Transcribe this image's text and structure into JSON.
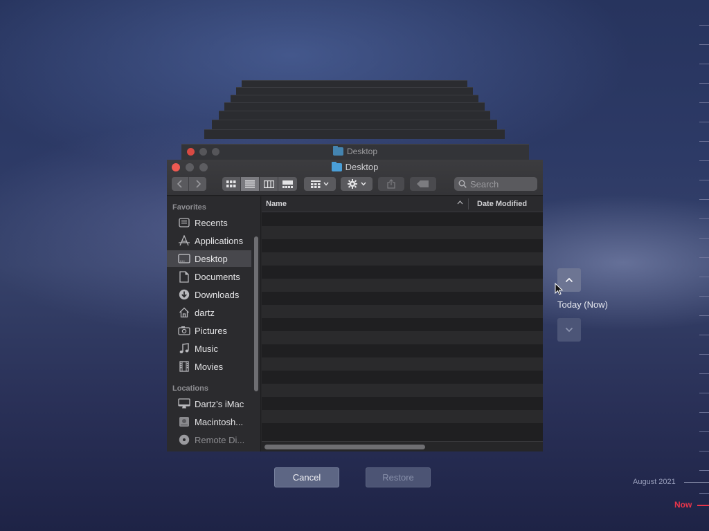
{
  "back_window": {
    "title": "Desktop"
  },
  "window": {
    "title": "Desktop",
    "search_placeholder": "Search",
    "sidebar": {
      "sections": [
        {
          "header": "Favorites",
          "items": [
            {
              "label": "Recents",
              "icon": "recents-icon"
            },
            {
              "label": "Applications",
              "icon": "applications-icon"
            },
            {
              "label": "Desktop",
              "icon": "desktop-icon",
              "selected": true
            },
            {
              "label": "Documents",
              "icon": "documents-icon"
            },
            {
              "label": "Downloads",
              "icon": "downloads-icon"
            },
            {
              "label": "dartz",
              "icon": "home-icon"
            },
            {
              "label": "Pictures",
              "icon": "pictures-icon"
            },
            {
              "label": "Music",
              "icon": "music-icon"
            },
            {
              "label": "Movies",
              "icon": "movies-icon"
            }
          ]
        },
        {
          "header": "Locations",
          "items": [
            {
              "label": "Dartz’s iMac",
              "icon": "imac-icon"
            },
            {
              "label": "Macintosh...",
              "icon": "disk-icon"
            },
            {
              "label": "Remote Di...",
              "icon": "remote-disc-icon"
            }
          ]
        }
      ]
    },
    "columns": {
      "name": "Name",
      "date_modified": "Date Modified"
    }
  },
  "dialog": {
    "cancel": "Cancel",
    "restore": "Restore"
  },
  "time_machine": {
    "current": "Today (Now)",
    "timeline_month": "August 2021",
    "now": "Now"
  },
  "colors": {
    "close": "#ee5a52",
    "minimize": "#5d5d61",
    "zoom": "#5d5d61",
    "now": "#e8354a"
  }
}
